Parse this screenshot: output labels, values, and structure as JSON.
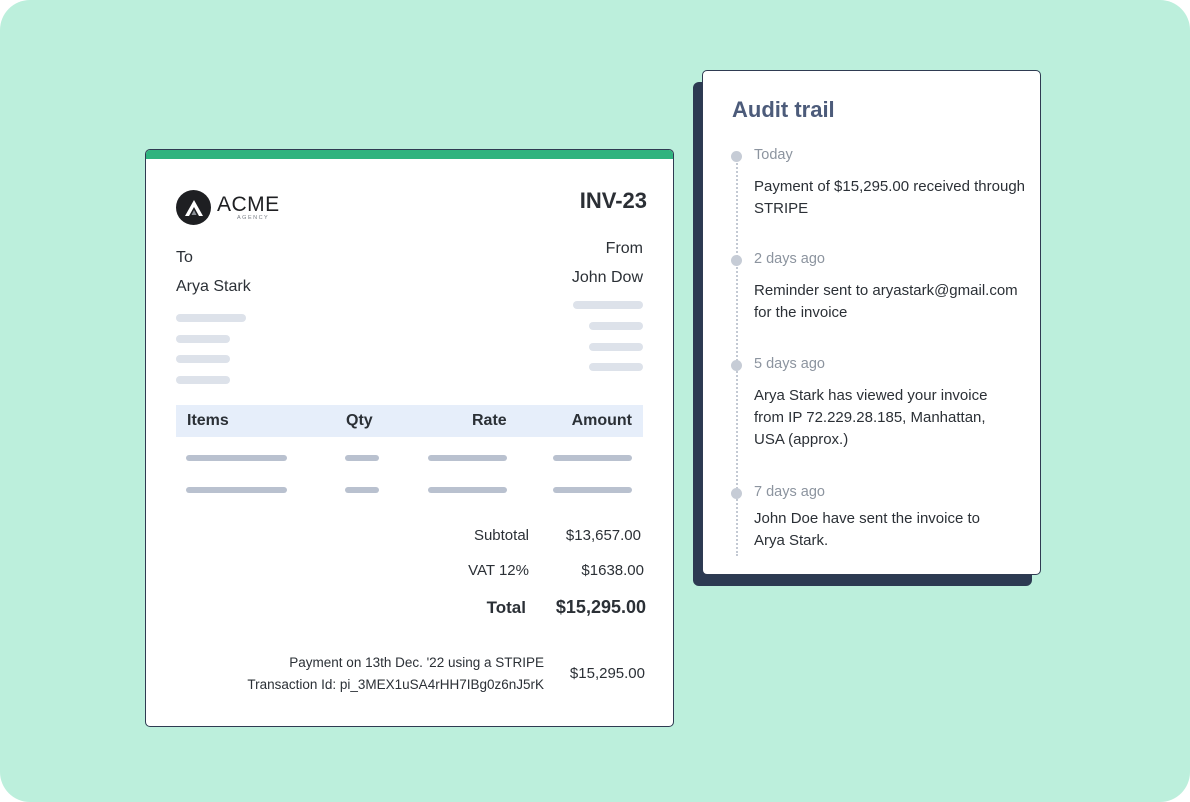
{
  "invoice": {
    "logo_name": "ACME",
    "logo_sub": "AGENCY",
    "number": "INV-23",
    "to_label": "To",
    "to_name": "Arya Stark",
    "from_label": "From",
    "from_name": "John Dow",
    "table_headers": [
      "Items",
      "Qty",
      "Rate",
      "Amount"
    ],
    "subtotal_label": "Subtotal",
    "subtotal_value": "$13,657.00",
    "vat_label": "VAT 12%",
    "vat_value": "$1638.00",
    "total_label": "Total",
    "total_value": "$15,295.00",
    "payment_line1": "Payment on 13th Dec. '22 using a STRIPE",
    "payment_line2": "Transaction Id: pi_3MEX1uSA4rHH7IBg0z6nJ5rK",
    "payment_amount": "$15,295.00",
    "accent_color": "#2fb37e"
  },
  "audit": {
    "title": "Audit trail",
    "events": [
      {
        "when": "Today",
        "text": "Payment of $15,295.00 received through STRIPE"
      },
      {
        "when": "2 days ago",
        "text": "Reminder sent to aryastark@gmail.com for the invoice"
      },
      {
        "when": "5 days ago",
        "text": "Arya Stark has viewed your invoice from IP 72.229.28.185, Manhattan, USA (approx.)"
      },
      {
        "when": "7 days ago",
        "text": "John Doe have sent the invoice to Arya Stark."
      }
    ]
  }
}
